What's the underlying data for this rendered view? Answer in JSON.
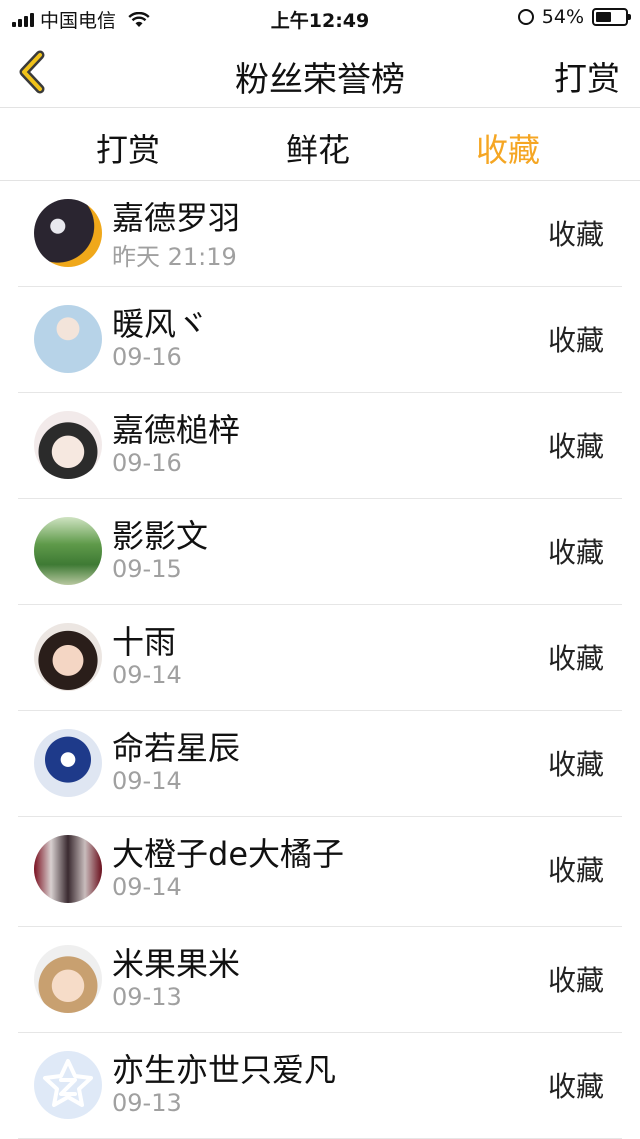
{
  "status_bar": {
    "carrier": "中国电信",
    "time": "上午12:49",
    "battery": "54%",
    "battery_level": 0.54
  },
  "nav": {
    "title": "粉丝荣誉榜",
    "right_action": "打赏",
    "back_icon": "chevron-left-icon"
  },
  "tabs": [
    {
      "label": "打赏",
      "active": false
    },
    {
      "label": "鲜花",
      "active": false
    },
    {
      "label": "收藏",
      "active": true
    }
  ],
  "colors": {
    "accent": "#f5a623",
    "text": "#111111",
    "secondary": "#a0a0a0",
    "divider": "#e6e6e6"
  },
  "rows": [
    {
      "name": "嘉德罗羽",
      "date": "昨天 21:19",
      "action": "收藏"
    },
    {
      "name": "暖风ヾ",
      "date": "09-16",
      "action": "收藏"
    },
    {
      "name": "嘉德槌梓",
      "date": "09-16",
      "action": "收藏"
    },
    {
      "name": "影影文",
      "date": "09-15",
      "action": "收藏"
    },
    {
      "name": "十雨",
      "date": "09-14",
      "action": "收藏"
    },
    {
      "name": "命若星辰",
      "date": "09-14",
      "action": "收藏"
    },
    {
      "name": "大橙子de大橘子",
      "date": "09-14",
      "action": "收藏"
    },
    {
      "name": "米果果米",
      "date": "09-13",
      "action": "收藏"
    },
    {
      "name": "亦生亦世只爱凡",
      "date": "09-13",
      "action": "收藏"
    }
  ]
}
